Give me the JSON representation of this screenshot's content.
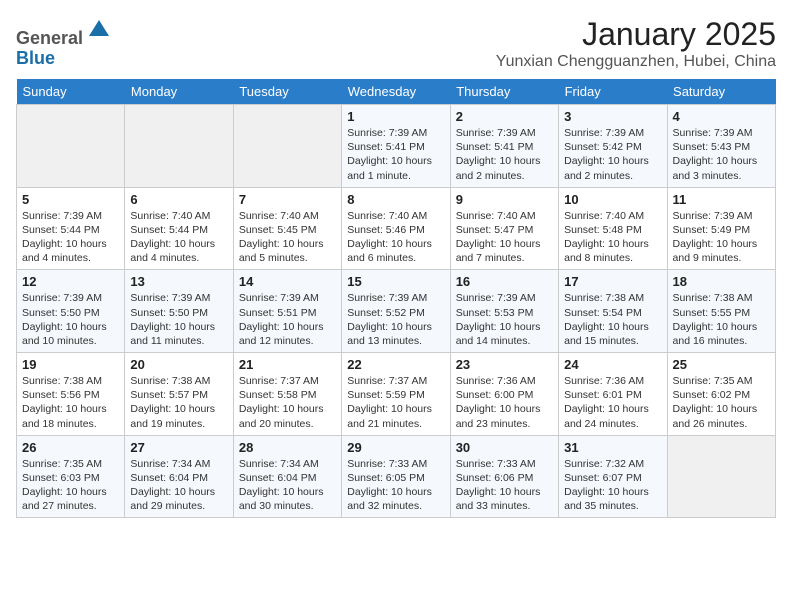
{
  "header": {
    "logo_line1": "General",
    "logo_line2": "Blue",
    "month": "January 2025",
    "location": "Yunxian Chengguanzhen, Hubei, China"
  },
  "weekdays": [
    "Sunday",
    "Monday",
    "Tuesday",
    "Wednesday",
    "Thursday",
    "Friday",
    "Saturday"
  ],
  "weeks": [
    [
      {
        "day": "",
        "content": ""
      },
      {
        "day": "",
        "content": ""
      },
      {
        "day": "",
        "content": ""
      },
      {
        "day": "1",
        "content": "Sunrise: 7:39 AM\nSunset: 5:41 PM\nDaylight: 10 hours\nand 1 minute."
      },
      {
        "day": "2",
        "content": "Sunrise: 7:39 AM\nSunset: 5:41 PM\nDaylight: 10 hours\nand 2 minutes."
      },
      {
        "day": "3",
        "content": "Sunrise: 7:39 AM\nSunset: 5:42 PM\nDaylight: 10 hours\nand 2 minutes."
      },
      {
        "day": "4",
        "content": "Sunrise: 7:39 AM\nSunset: 5:43 PM\nDaylight: 10 hours\nand 3 minutes."
      }
    ],
    [
      {
        "day": "5",
        "content": "Sunrise: 7:39 AM\nSunset: 5:44 PM\nDaylight: 10 hours\nand 4 minutes."
      },
      {
        "day": "6",
        "content": "Sunrise: 7:40 AM\nSunset: 5:44 PM\nDaylight: 10 hours\nand 4 minutes."
      },
      {
        "day": "7",
        "content": "Sunrise: 7:40 AM\nSunset: 5:45 PM\nDaylight: 10 hours\nand 5 minutes."
      },
      {
        "day": "8",
        "content": "Sunrise: 7:40 AM\nSunset: 5:46 PM\nDaylight: 10 hours\nand 6 minutes."
      },
      {
        "day": "9",
        "content": "Sunrise: 7:40 AM\nSunset: 5:47 PM\nDaylight: 10 hours\nand 7 minutes."
      },
      {
        "day": "10",
        "content": "Sunrise: 7:40 AM\nSunset: 5:48 PM\nDaylight: 10 hours\nand 8 minutes."
      },
      {
        "day": "11",
        "content": "Sunrise: 7:39 AM\nSunset: 5:49 PM\nDaylight: 10 hours\nand 9 minutes."
      }
    ],
    [
      {
        "day": "12",
        "content": "Sunrise: 7:39 AM\nSunset: 5:50 PM\nDaylight: 10 hours\nand 10 minutes."
      },
      {
        "day": "13",
        "content": "Sunrise: 7:39 AM\nSunset: 5:50 PM\nDaylight: 10 hours\nand 11 minutes."
      },
      {
        "day": "14",
        "content": "Sunrise: 7:39 AM\nSunset: 5:51 PM\nDaylight: 10 hours\nand 12 minutes."
      },
      {
        "day": "15",
        "content": "Sunrise: 7:39 AM\nSunset: 5:52 PM\nDaylight: 10 hours\nand 13 minutes."
      },
      {
        "day": "16",
        "content": "Sunrise: 7:39 AM\nSunset: 5:53 PM\nDaylight: 10 hours\nand 14 minutes."
      },
      {
        "day": "17",
        "content": "Sunrise: 7:38 AM\nSunset: 5:54 PM\nDaylight: 10 hours\nand 15 minutes."
      },
      {
        "day": "18",
        "content": "Sunrise: 7:38 AM\nSunset: 5:55 PM\nDaylight: 10 hours\nand 16 minutes."
      }
    ],
    [
      {
        "day": "19",
        "content": "Sunrise: 7:38 AM\nSunset: 5:56 PM\nDaylight: 10 hours\nand 18 minutes."
      },
      {
        "day": "20",
        "content": "Sunrise: 7:38 AM\nSunset: 5:57 PM\nDaylight: 10 hours\nand 19 minutes."
      },
      {
        "day": "21",
        "content": "Sunrise: 7:37 AM\nSunset: 5:58 PM\nDaylight: 10 hours\nand 20 minutes."
      },
      {
        "day": "22",
        "content": "Sunrise: 7:37 AM\nSunset: 5:59 PM\nDaylight: 10 hours\nand 21 minutes."
      },
      {
        "day": "23",
        "content": "Sunrise: 7:36 AM\nSunset: 6:00 PM\nDaylight: 10 hours\nand 23 minutes."
      },
      {
        "day": "24",
        "content": "Sunrise: 7:36 AM\nSunset: 6:01 PM\nDaylight: 10 hours\nand 24 minutes."
      },
      {
        "day": "25",
        "content": "Sunrise: 7:35 AM\nSunset: 6:02 PM\nDaylight: 10 hours\nand 26 minutes."
      }
    ],
    [
      {
        "day": "26",
        "content": "Sunrise: 7:35 AM\nSunset: 6:03 PM\nDaylight: 10 hours\nand 27 minutes."
      },
      {
        "day": "27",
        "content": "Sunrise: 7:34 AM\nSunset: 6:04 PM\nDaylight: 10 hours\nand 29 minutes."
      },
      {
        "day": "28",
        "content": "Sunrise: 7:34 AM\nSunset: 6:04 PM\nDaylight: 10 hours\nand 30 minutes."
      },
      {
        "day": "29",
        "content": "Sunrise: 7:33 AM\nSunset: 6:05 PM\nDaylight: 10 hours\nand 32 minutes."
      },
      {
        "day": "30",
        "content": "Sunrise: 7:33 AM\nSunset: 6:06 PM\nDaylight: 10 hours\nand 33 minutes."
      },
      {
        "day": "31",
        "content": "Sunrise: 7:32 AM\nSunset: 6:07 PM\nDaylight: 10 hours\nand 35 minutes."
      },
      {
        "day": "",
        "content": ""
      }
    ]
  ]
}
